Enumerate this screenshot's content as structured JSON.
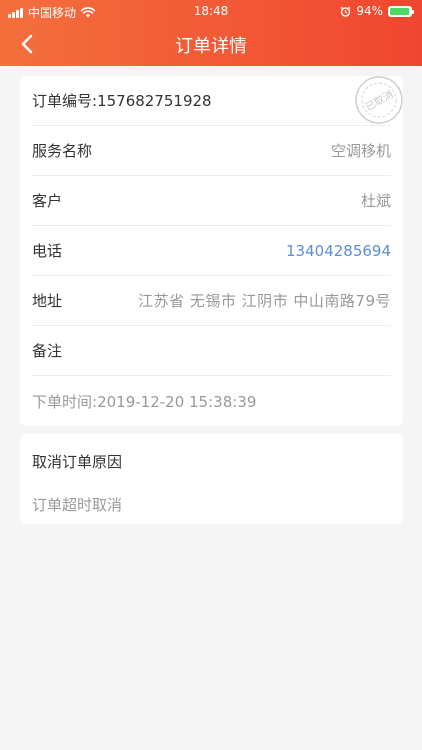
{
  "status_bar": {
    "carrier": "中国移动",
    "time": "18:48",
    "battery": "94%"
  },
  "nav": {
    "title": "订单详情",
    "back_icon": "chevron-left-icon"
  },
  "order": {
    "number_label": "订单编号:",
    "number": "157682751928",
    "status_stamp": "已取消",
    "fields": [
      {
        "label": "服务名称",
        "value": "空调移机"
      },
      {
        "label": "客户",
        "value": "杜斌"
      },
      {
        "label": "电话",
        "value": "13404285694"
      },
      {
        "label": "地址",
        "value": "江苏省 无锡市 江阴市 中山南路79号"
      },
      {
        "label": "备注",
        "value": ""
      }
    ],
    "time_label": "下单时间:",
    "time": "2019-12-20 15:38:39"
  },
  "cancel": {
    "title": "取消订单原因",
    "reason": "订单超时取消"
  },
  "colors": {
    "header_start": "#f46f3c",
    "header_end": "#f0462f",
    "phone": "#5b8fd1"
  }
}
